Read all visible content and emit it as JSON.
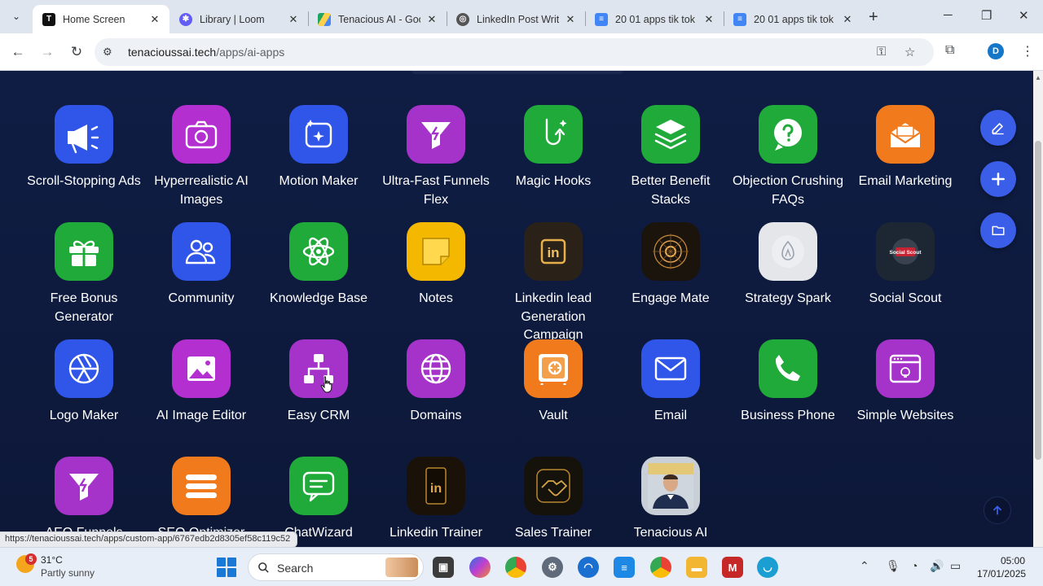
{
  "browser": {
    "tabs": [
      {
        "title": "Home Screen",
        "active": true
      },
      {
        "title": "Library | Loom",
        "active": false
      },
      {
        "title": "Tenacious AI - Goo",
        "active": false
      },
      {
        "title": "LinkedIn Post Writ",
        "active": false
      },
      {
        "title": "20 01 apps tik tok",
        "active": false
      },
      {
        "title": "20 01 apps tik tok",
        "active": false
      }
    ],
    "new_tab": "+",
    "url_host": "tenacioussai.tech",
    "url_path": "/apps/ai-apps",
    "profile_initial": "D"
  },
  "apps": [
    {
      "label": "Scroll-Stopping Ads",
      "icon": "megaphone-icon",
      "color": "#2f56e8"
    },
    {
      "label": "Hyperrealistic AI Images",
      "icon": "camera-icon",
      "color": "#b42fd0"
    },
    {
      "label": "Motion Maker",
      "icon": "motion-icon",
      "color": "#2f56e8"
    },
    {
      "label": "Ultra-Fast Funnels Flex",
      "icon": "funnel-icon",
      "color": "#a533c9"
    },
    {
      "label": "Magic Hooks",
      "icon": "hook-icon",
      "color": "#1faa3a"
    },
    {
      "label": "Better Benefit Stacks",
      "icon": "layers-icon",
      "color": "#1faa3a"
    },
    {
      "label": "Objection Crushing FAQs",
      "icon": "question-icon",
      "color": "#1faa3a"
    },
    {
      "label": "Email Marketing",
      "icon": "envelope-open-icon",
      "color": "#f07a1c"
    },
    {
      "label": "Free Bonus Generator",
      "icon": "gift-icon",
      "color": "#1faa3a"
    },
    {
      "label": "Community",
      "icon": "people-icon",
      "color": "#2f56e8"
    },
    {
      "label": "Knowledge Base",
      "icon": "atom-icon",
      "color": "#1faa3a"
    },
    {
      "label": "Notes",
      "icon": "note-icon",
      "color": "#f5b800"
    },
    {
      "label": "Linkedin lead Generation Campaign",
      "icon": "linkedin-gold-icon",
      "color": "#2a2118"
    },
    {
      "label": "Engage Mate",
      "icon": "engage-mate-icon",
      "color": "#1b140d"
    },
    {
      "label": "Strategy Spark",
      "icon": "strategy-spark-icon",
      "color": "#e4e6ea"
    },
    {
      "label": "Social Scout",
      "icon": "social-scout-icon",
      "color": "#1d2633"
    },
    {
      "label": "Logo Maker",
      "icon": "aperture-icon",
      "color": "#2f56e8"
    },
    {
      "label": "AI Image Editor",
      "icon": "image-icon",
      "color": "#b42fd0"
    },
    {
      "label": "Easy CRM",
      "icon": "hierarchy-icon",
      "color": "#a533c9"
    },
    {
      "label": "Domains",
      "icon": "globe-icon",
      "color": "#a533c9"
    },
    {
      "label": "Vault",
      "icon": "vault-icon",
      "color": "#f07a1c"
    },
    {
      "label": "Email",
      "icon": "envelope-icon",
      "color": "#2f56e8"
    },
    {
      "label": "Business Phone",
      "icon": "phone-icon",
      "color": "#1faa3a"
    },
    {
      "label": "Simple Websites",
      "icon": "browser-window-icon",
      "color": "#a533c9"
    },
    {
      "label": "AEO Funnels",
      "icon": "funnel-icon",
      "color": "#a533c9"
    },
    {
      "label": "SEO Optimizer",
      "icon": "menu-lines-icon",
      "color": "#f07a1c"
    },
    {
      "label": "ChatWizard",
      "icon": "chat-icon",
      "color": "#1faa3a"
    },
    {
      "label": "Linkedin Trainer",
      "icon": "linkedin-trainer-icon",
      "color": "#1a1208"
    },
    {
      "label": "Sales Trainer",
      "icon": "handshake-icon",
      "color": "#15120c"
    },
    {
      "label": "Tenacious AI",
      "icon": "person-photo-icon",
      "color": "#c9cfd6"
    }
  ],
  "fab": {
    "edit": "edit-icon",
    "add": "plus-icon",
    "folder": "folder-icon"
  },
  "status_url": "https://tenacioussai.tech/apps/custom-app/6767edb2d8305ef58c119c52",
  "taskbar": {
    "weather_temp": "31°C",
    "weather_desc": "Partly sunny",
    "weather_badge": "5",
    "search_placeholder": "Search",
    "time": "05:00",
    "date": "17/01/2025"
  }
}
